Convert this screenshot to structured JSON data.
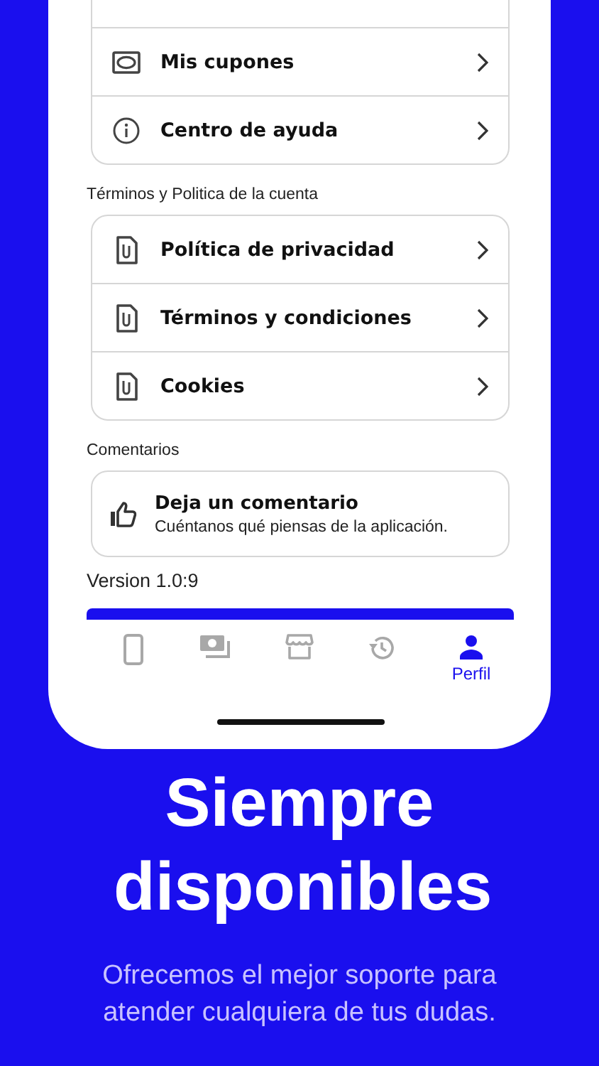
{
  "sections": [
    {
      "items": [
        {
          "kind": "coupon",
          "label": "Mis cupones"
        },
        {
          "kind": "info",
          "label": "Centro de ayuda"
        }
      ]
    },
    {
      "title": "Términos y Politica de la cuenta",
      "items": [
        {
          "kind": "document",
          "label": "Política de privacidad"
        },
        {
          "kind": "document",
          "label": "Términos y condiciones"
        },
        {
          "kind": "document",
          "label": "Cookies"
        }
      ]
    }
  ],
  "feedback": {
    "heading": "Comentarios",
    "title": "Deja un comentario",
    "subtitle": "Cuéntanos qué piensas de la aplicación."
  },
  "version": "Version 1.0:9",
  "tabs": [
    {
      "kind": "phone",
      "selected": false
    },
    {
      "kind": "cash",
      "selected": false
    },
    {
      "kind": "store",
      "selected": false
    },
    {
      "kind": "history",
      "selected": false
    },
    {
      "kind": "person",
      "label": "Perfil",
      "selected": true
    }
  ],
  "headline": "Siempre disponibles",
  "tagline": "Ofrecemos el mejor soporte para atender cualquiera de tus dudas."
}
